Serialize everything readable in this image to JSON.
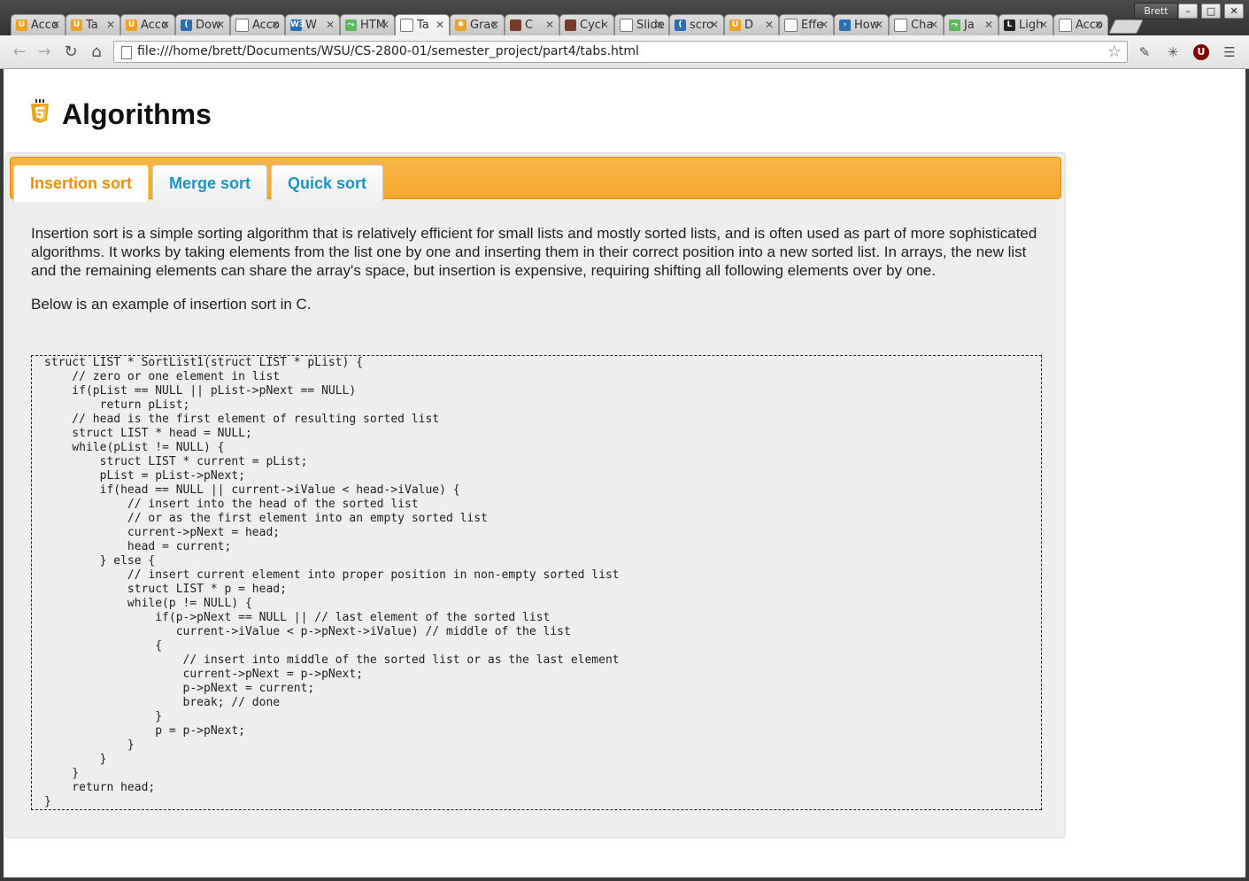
{
  "browser": {
    "user_label": "Brett",
    "tabs": [
      {
        "label": "Acco",
        "icon": "u-icon",
        "color": "#f0a020"
      },
      {
        "label": "Ta",
        "icon": "u-icon",
        "color": "#f0a020"
      },
      {
        "label": "Acco",
        "icon": "u-icon",
        "color": "#f0a020"
      },
      {
        "label": "Dow",
        "icon": "jquery-icon",
        "color": "#2a6fb3"
      },
      {
        "label": "Acco",
        "icon": "page-icon",
        "color": "#ffffff"
      },
      {
        "label": "W",
        "icon": "w3schools-icon",
        "color": "#2a6fb3"
      },
      {
        "label": "HTM",
        "icon": "w3c-icon",
        "color": "#5cb85c"
      },
      {
        "label": "Ta",
        "icon": "page-icon",
        "color": "#ffffff",
        "active": true
      },
      {
        "label": "Grac",
        "icon": "gear-icon",
        "color": "#f0a020"
      },
      {
        "label": "C",
        "icon": "avatar-icon",
        "color": "#7a3a2a"
      },
      {
        "label": "Cycl",
        "icon": "avatar-icon",
        "color": "#7a3a2a"
      },
      {
        "label": "Slide",
        "icon": "page-icon",
        "color": "#ffffff"
      },
      {
        "label": "scro",
        "icon": "jquery-icon",
        "color": "#2a6fb3"
      },
      {
        "label": "D",
        "icon": "u-icon",
        "color": "#f0a020"
      },
      {
        "label": "Effe",
        "icon": "page-icon",
        "color": "#ffffff"
      },
      {
        "label": "How",
        "icon": "arrow-icon",
        "color": "#2a6fb3"
      },
      {
        "label": "Cha",
        "icon": "page-icon",
        "color": "#ffffff"
      },
      {
        "label": "Ja",
        "icon": "w3c-icon",
        "color": "#5cb85c"
      },
      {
        "label": "Ligh",
        "icon": "l-icon",
        "color": "#222222"
      },
      {
        "label": "Acco",
        "icon": "page-icon",
        "color": "#ffffff"
      }
    ],
    "url": "file:///home/brett/Documents/WSU/CS-2800-01/semester_project/part4/tabs.html"
  },
  "page": {
    "title": "Algorithms",
    "tabs": [
      {
        "label": "Insertion sort",
        "active": true
      },
      {
        "label": "Merge sort",
        "active": false
      },
      {
        "label": "Quick sort",
        "active": false
      }
    ],
    "paragraph1": "Insertion sort is a simple sorting algorithm that is relatively efficient for small lists and mostly sorted lists, and is often used as part of more sophisticated algorithms. It works by taking elements from the list one by one and inserting them in their correct position into a new sorted list. In arrays, the new list and the remaining elements can share the array's space, but insertion is expensive, requiring shifting all following elements over by one.",
    "paragraph2": "Below is an example of insertion sort in C.",
    "code": "struct LIST * SortList1(struct LIST * pList) {\n    // zero or one element in list\n    if(pList == NULL || pList->pNext == NULL)\n        return pList;\n    // head is the first element of resulting sorted list\n    struct LIST * head = NULL;\n    while(pList != NULL) {\n        struct LIST * current = pList;\n        pList = pList->pNext;\n        if(head == NULL || current->iValue < head->iValue) {\n            // insert into the head of the sorted list\n            // or as the first element into an empty sorted list\n            current->pNext = head;\n            head = current;\n        } else {\n            // insert current element into proper position in non-empty sorted list\n            struct LIST * p = head;\n            while(p != NULL) {\n                if(p->pNext == NULL || // last element of the sorted list\n                   current->iValue < p->pNext->iValue) // middle of the list\n                {\n                    // insert into middle of the sorted list or as the last element\n                    current->pNext = p->pNext;\n                    p->pNext = current;\n                    break; // done\n                }\n                p = p->pNext;\n            }\n        }\n    }\n    return head;\n}"
  }
}
